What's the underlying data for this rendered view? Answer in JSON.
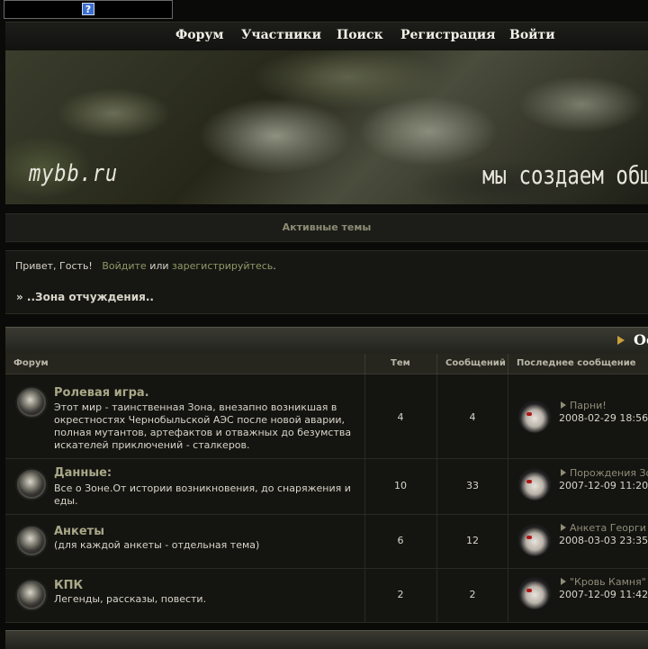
{
  "nav": [
    "Форум",
    "Участники",
    "Поиск",
    "Регистрация",
    "Войти"
  ],
  "help_icon": "?",
  "banner": {
    "logo": "mybb.ru",
    "slogan": "мы создаем общ"
  },
  "active_topics": "Активные темы",
  "greeting": {
    "hello": "Привет, Гость!",
    "login": "Войдите",
    "or": "или",
    "register": "зарегистрируйтесь",
    "dot": "."
  },
  "breadcrumb": "» ..Зона отчуждения..",
  "category": {
    "title": "Ос",
    "columns": {
      "forum": "Форум",
      "topics": "Тем",
      "posts": "Сообщений",
      "last": "Последнее сообщение"
    }
  },
  "forums": [
    {
      "name": "Ролевая игра.",
      "desc": "Этот мир - таинственная Зона, внезапно возникшая в окрестностях Чернобыльской АЭС после новой аварии, полная мутантов, артефактов и отважных до безумства искателей приключений - сталкеров.",
      "topics": "4",
      "posts": "4",
      "last_title": "Парни!",
      "last_date": "2008-02-29 18:56"
    },
    {
      "name": "Данные:",
      "desc": "Все о Зоне.От истории возникновения, до снаряжения и еды.",
      "topics": "10",
      "posts": "33",
      "last_title": "Порождения Зо",
      "last_date": "2007-12-09 11:20"
    },
    {
      "name": "Анкеты",
      "desc": "(для каждой анкеты - отдельная тема)",
      "topics": "6",
      "posts": "12",
      "last_title": "Анкета Георги",
      "last_date": "2008-03-03 23:35"
    },
    {
      "name": "КПК",
      "desc": "Легенды, рассказы, повести.",
      "topics": "2",
      "posts": "2",
      "last_title": "\"Кровь Камня\"",
      "last_date": "2007-12-09 11:42"
    }
  ]
}
